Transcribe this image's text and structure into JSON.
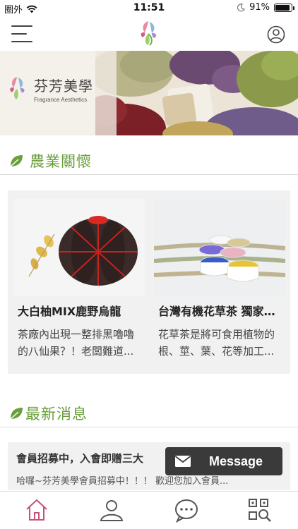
{
  "status": {
    "carrier": "圈外",
    "time": "11:51",
    "battery_text": "91%",
    "battery_level": 0.91,
    "wifi_icon": "wifi-icon",
    "moon_icon": "moon-icon"
  },
  "header": {
    "menu_icon": "hamburger-menu-icon",
    "logo_icon": "fragrance-logo-icon",
    "user_icon": "user-profile-icon"
  },
  "banner": {
    "brand_title": "芬芳美學",
    "brand_subtitle": "Fragrance Aesthetics"
  },
  "agriculture": {
    "section_title": "農業關懷",
    "cards": [
      {
        "title": "大白柚MIX鹿野烏龍",
        "desc": "茶廠內出現一整排黑嚕嚕的八仙果？！老闆難道..."
      },
      {
        "title": "台灣有機花草茶 獨家推薦",
        "desc": "花草茶是將可食用植物的根、莖、葉、花等加工..."
      }
    ]
  },
  "news": {
    "section_title": "最新消息",
    "items": [
      {
        "title": "會員招募中，入會即贈三大",
        "desc": "哈囉~芬芳美學會員招募中！！！ 歡迎您加入會員..."
      }
    ]
  },
  "message": {
    "label": "Message",
    "icon": "mail-icon"
  },
  "tabs": [
    {
      "icon": "home-icon"
    },
    {
      "icon": "user-icon"
    },
    {
      "icon": "chat-icon"
    },
    {
      "icon": "qr-scan-icon"
    }
  ],
  "colors": {
    "accent_green": "#6b9e3c",
    "home_pink": "#c9507c",
    "tab_gray": "#555555"
  }
}
